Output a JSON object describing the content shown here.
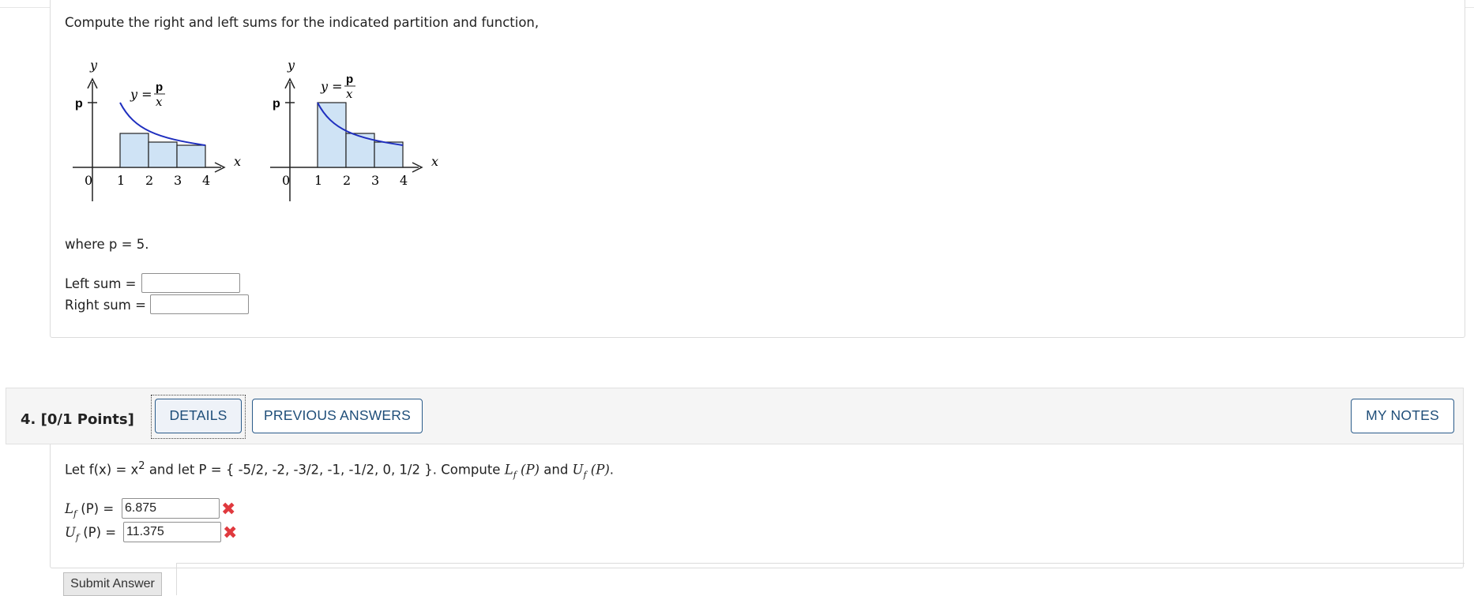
{
  "question3": {
    "prompt": "Compute the right and left sums for the indicated partition and function,",
    "where_text": "where p = 5.",
    "left_sum_label": "Left sum =",
    "right_sum_label": "Right sum =",
    "left_sum_value": "",
    "right_sum_value": "",
    "graph": {
      "axis_y": "y",
      "axis_x": "x",
      "p_tick": "p",
      "origin": "0",
      "ticks": [
        "1",
        "2",
        "3",
        "4"
      ],
      "curve_label_left": "y =",
      "curve_label_num": "p",
      "curve_label_den": "x"
    }
  },
  "question4": {
    "title": "4. [0/1 Points]",
    "details_label": "DETAILS",
    "previous_answers_label": "PREVIOUS ANSWERS",
    "my_notes_label": "MY NOTES",
    "prompt_a": "Let f(x) = x",
    "prompt_sup": "2",
    "prompt_b": " and let P = { -5/2, -2, -3/2, -1, -1/2, 0, 1/2 }. Compute ",
    "prompt_L": "L",
    "prompt_f": "f",
    "prompt_P": " (P)",
    "prompt_and": " and ",
    "prompt_U": "U",
    "prompt_end": ".",
    "lower_label_eq": " (P) =",
    "upper_label_eq": " (P) =",
    "lower_value": "6.875",
    "upper_value": "11.375",
    "submit_label": "Submit Answer"
  }
}
